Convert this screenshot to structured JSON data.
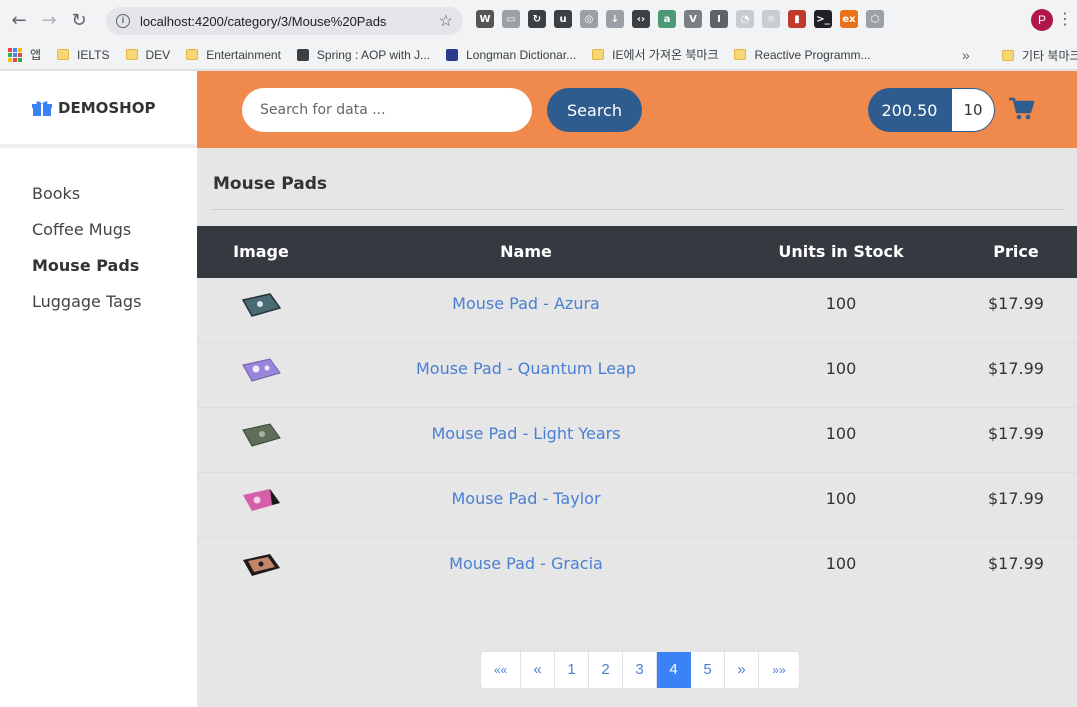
{
  "browser": {
    "url": "localhost:4200/category/3/Mouse%20Pads",
    "profile_initial": "P",
    "bookmarks": [
      {
        "label": "앱",
        "icon": "apps-icon"
      },
      {
        "label": "IELTS",
        "icon": "folder-icon"
      },
      {
        "label": "DEV",
        "icon": "folder-icon"
      },
      {
        "label": "Entertainment",
        "icon": "folder-icon"
      },
      {
        "label": "Spring : AOP with J...",
        "icon": "site-icon"
      },
      {
        "label": "Longman Dictionar...",
        "icon": "site-icon"
      },
      {
        "label": "IE에서 가져온 북마크",
        "icon": "folder-icon"
      },
      {
        "label": "Reactive Programm...",
        "icon": "folder-icon"
      }
    ],
    "bookmarks_more": "»",
    "bookmarks_other": "기타 북마크"
  },
  "sidebar": {
    "brand": "DEMOSHOP",
    "categories": [
      "Books",
      "Coffee Mugs",
      "Mouse Pads",
      "Luggage Tags"
    ],
    "active_category": "Mouse Pads"
  },
  "header": {
    "search_placeholder": "Search for data ...",
    "search_label": "Search",
    "cart_total": "200.50",
    "cart_quantity": "10",
    "accent_color": "#ef8a4c",
    "primary_color": "#2e5c8e"
  },
  "main": {
    "title": "Mouse Pads",
    "columns": [
      "Image",
      "Name",
      "Units in Stock",
      "Price"
    ],
    "products": [
      {
        "name": "Mouse Pad - Azura",
        "stock": "100",
        "price": "$17.99",
        "color": "#4a6b74"
      },
      {
        "name": "Mouse Pad - Quantum Leap",
        "stock": "100",
        "price": "$17.99",
        "color": "#9a86d8"
      },
      {
        "name": "Mouse Pad - Light Years",
        "stock": "100",
        "price": "$17.99",
        "color": "#5f6e58"
      },
      {
        "name": "Mouse Pad - Taylor",
        "stock": "100",
        "price": "$17.99",
        "color": "#d35fa8"
      },
      {
        "name": "Mouse Pad - Gracia",
        "stock": "100",
        "price": "$17.99",
        "color": "#c4866a"
      }
    ]
  },
  "pagination": {
    "first": "««",
    "prev": "«",
    "pages": [
      "1",
      "2",
      "3",
      "4",
      "5"
    ],
    "current": "4",
    "next": "»",
    "last": "»»"
  }
}
